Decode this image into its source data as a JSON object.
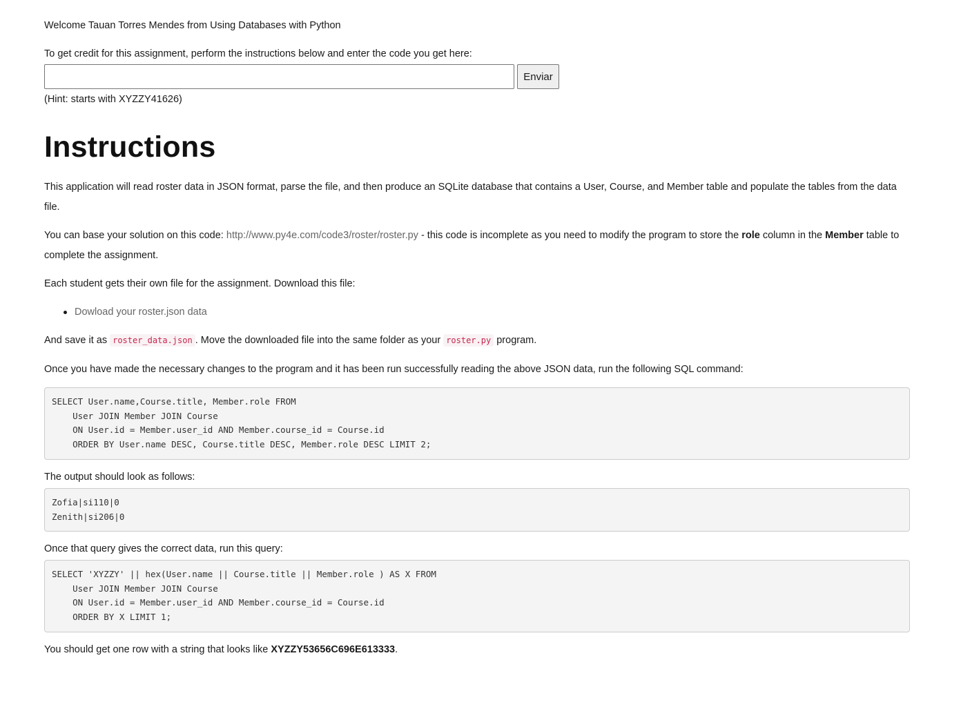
{
  "header": {
    "welcome": "Welcome Tauan Torres Mendes from Using Databases with Python",
    "credit_label": "To get credit for this assignment, perform the instructions below and enter the code you get here:",
    "input_value": "",
    "submit_label": "Enviar",
    "hint": "(Hint: starts with XYZZY41626)"
  },
  "instructions": {
    "title": "Instructions",
    "intro": "This application will read roster data in JSON format, parse the file, and then produce an SQLite database that contains a User, Course, and Member table and populate the tables from the data file.",
    "base_prefix": "You can base your solution on this code: ",
    "base_link": "http://www.py4e.com/code3/roster/roster.py",
    "base_middle": " - this code is incomplete as you need to modify the program to store the ",
    "base_bold_role": "role",
    "base_after_role": " column in the ",
    "base_bold_member": "Member",
    "base_suffix": " table to complete the assignment.",
    "each_student": "Each student gets their own file for the assignment. Download this file:",
    "download_link": "Dowload your roster.json data",
    "save_prefix": "And save it as ",
    "save_file": "roster_data.json",
    "save_middle": ". Move the downloaded file into the same folder as your ",
    "save_program": "roster.py",
    "save_suffix": " program.",
    "once_made": "Once you have made the necessary changes to the program and it has been run successfully reading the above JSON data, run the following SQL command:",
    "sql_query_1": "SELECT User.name,Course.title, Member.role FROM \n    User JOIN Member JOIN Course \n    ON User.id = Member.user_id AND Member.course_id = Course.id\n    ORDER BY User.name DESC, Course.title DESC, Member.role DESC LIMIT 2;",
    "output_label": "The output should look as follows:",
    "output_sample": "Zofia|si110|0\nZenith|si206|0",
    "once_query": "Once that query gives the correct data, run this query:",
    "sql_query_2": "SELECT 'XYZZY' || hex(User.name || Course.title || Member.role ) AS X FROM \n    User JOIN Member JOIN Course \n    ON User.id = Member.user_id AND Member.course_id = Course.id\n    ORDER BY X LIMIT 1;",
    "should_get_prefix": "You should get one row with a string that looks like ",
    "should_get_code": "XYZZY53656C696E613333",
    "should_get_suffix": "."
  }
}
